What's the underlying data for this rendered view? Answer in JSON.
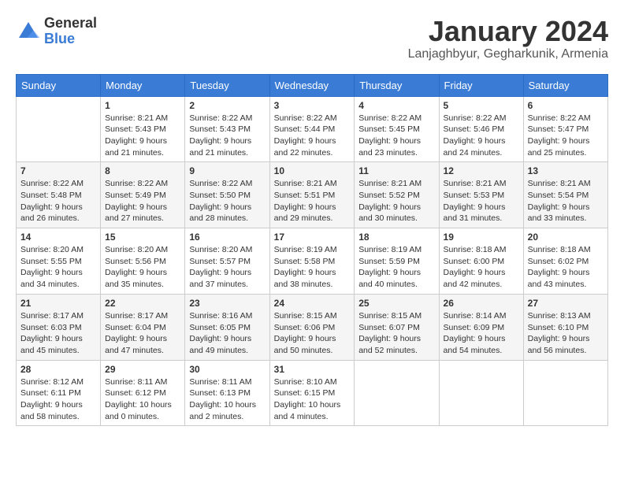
{
  "header": {
    "logo_general": "General",
    "logo_blue": "Blue",
    "month_title": "January 2024",
    "location": "Lanjaghbyur, Gegharkunik, Armenia"
  },
  "calendar": {
    "days_of_week": [
      "Sunday",
      "Monday",
      "Tuesday",
      "Wednesday",
      "Thursday",
      "Friday",
      "Saturday"
    ],
    "weeks": [
      [
        {
          "day": "",
          "sunrise": "",
          "sunset": "",
          "daylight": ""
        },
        {
          "day": "1",
          "sunrise": "Sunrise: 8:21 AM",
          "sunset": "Sunset: 5:43 PM",
          "daylight": "Daylight: 9 hours and 21 minutes."
        },
        {
          "day": "2",
          "sunrise": "Sunrise: 8:22 AM",
          "sunset": "Sunset: 5:43 PM",
          "daylight": "Daylight: 9 hours and 21 minutes."
        },
        {
          "day": "3",
          "sunrise": "Sunrise: 8:22 AM",
          "sunset": "Sunset: 5:44 PM",
          "daylight": "Daylight: 9 hours and 22 minutes."
        },
        {
          "day": "4",
          "sunrise": "Sunrise: 8:22 AM",
          "sunset": "Sunset: 5:45 PM",
          "daylight": "Daylight: 9 hours and 23 minutes."
        },
        {
          "day": "5",
          "sunrise": "Sunrise: 8:22 AM",
          "sunset": "Sunset: 5:46 PM",
          "daylight": "Daylight: 9 hours and 24 minutes."
        },
        {
          "day": "6",
          "sunrise": "Sunrise: 8:22 AM",
          "sunset": "Sunset: 5:47 PM",
          "daylight": "Daylight: 9 hours and 25 minutes."
        }
      ],
      [
        {
          "day": "7",
          "sunrise": "Sunrise: 8:22 AM",
          "sunset": "Sunset: 5:48 PM",
          "daylight": "Daylight: 9 hours and 26 minutes."
        },
        {
          "day": "8",
          "sunrise": "Sunrise: 8:22 AM",
          "sunset": "Sunset: 5:49 PM",
          "daylight": "Daylight: 9 hours and 27 minutes."
        },
        {
          "day": "9",
          "sunrise": "Sunrise: 8:22 AM",
          "sunset": "Sunset: 5:50 PM",
          "daylight": "Daylight: 9 hours and 28 minutes."
        },
        {
          "day": "10",
          "sunrise": "Sunrise: 8:21 AM",
          "sunset": "Sunset: 5:51 PM",
          "daylight": "Daylight: 9 hours and 29 minutes."
        },
        {
          "day": "11",
          "sunrise": "Sunrise: 8:21 AM",
          "sunset": "Sunset: 5:52 PM",
          "daylight": "Daylight: 9 hours and 30 minutes."
        },
        {
          "day": "12",
          "sunrise": "Sunrise: 8:21 AM",
          "sunset": "Sunset: 5:53 PM",
          "daylight": "Daylight: 9 hours and 31 minutes."
        },
        {
          "day": "13",
          "sunrise": "Sunrise: 8:21 AM",
          "sunset": "Sunset: 5:54 PM",
          "daylight": "Daylight: 9 hours and 33 minutes."
        }
      ],
      [
        {
          "day": "14",
          "sunrise": "Sunrise: 8:20 AM",
          "sunset": "Sunset: 5:55 PM",
          "daylight": "Daylight: 9 hours and 34 minutes."
        },
        {
          "day": "15",
          "sunrise": "Sunrise: 8:20 AM",
          "sunset": "Sunset: 5:56 PM",
          "daylight": "Daylight: 9 hours and 35 minutes."
        },
        {
          "day": "16",
          "sunrise": "Sunrise: 8:20 AM",
          "sunset": "Sunset: 5:57 PM",
          "daylight": "Daylight: 9 hours and 37 minutes."
        },
        {
          "day": "17",
          "sunrise": "Sunrise: 8:19 AM",
          "sunset": "Sunset: 5:58 PM",
          "daylight": "Daylight: 9 hours and 38 minutes."
        },
        {
          "day": "18",
          "sunrise": "Sunrise: 8:19 AM",
          "sunset": "Sunset: 5:59 PM",
          "daylight": "Daylight: 9 hours and 40 minutes."
        },
        {
          "day": "19",
          "sunrise": "Sunrise: 8:18 AM",
          "sunset": "Sunset: 6:00 PM",
          "daylight": "Daylight: 9 hours and 42 minutes."
        },
        {
          "day": "20",
          "sunrise": "Sunrise: 8:18 AM",
          "sunset": "Sunset: 6:02 PM",
          "daylight": "Daylight: 9 hours and 43 minutes."
        }
      ],
      [
        {
          "day": "21",
          "sunrise": "Sunrise: 8:17 AM",
          "sunset": "Sunset: 6:03 PM",
          "daylight": "Daylight: 9 hours and 45 minutes."
        },
        {
          "day": "22",
          "sunrise": "Sunrise: 8:17 AM",
          "sunset": "Sunset: 6:04 PM",
          "daylight": "Daylight: 9 hours and 47 minutes."
        },
        {
          "day": "23",
          "sunrise": "Sunrise: 8:16 AM",
          "sunset": "Sunset: 6:05 PM",
          "daylight": "Daylight: 9 hours and 49 minutes."
        },
        {
          "day": "24",
          "sunrise": "Sunrise: 8:15 AM",
          "sunset": "Sunset: 6:06 PM",
          "daylight": "Daylight: 9 hours and 50 minutes."
        },
        {
          "day": "25",
          "sunrise": "Sunrise: 8:15 AM",
          "sunset": "Sunset: 6:07 PM",
          "daylight": "Daylight: 9 hours and 52 minutes."
        },
        {
          "day": "26",
          "sunrise": "Sunrise: 8:14 AM",
          "sunset": "Sunset: 6:09 PM",
          "daylight": "Daylight: 9 hours and 54 minutes."
        },
        {
          "day": "27",
          "sunrise": "Sunrise: 8:13 AM",
          "sunset": "Sunset: 6:10 PM",
          "daylight": "Daylight: 9 hours and 56 minutes."
        }
      ],
      [
        {
          "day": "28",
          "sunrise": "Sunrise: 8:12 AM",
          "sunset": "Sunset: 6:11 PM",
          "daylight": "Daylight: 9 hours and 58 minutes."
        },
        {
          "day": "29",
          "sunrise": "Sunrise: 8:11 AM",
          "sunset": "Sunset: 6:12 PM",
          "daylight": "Daylight: 10 hours and 0 minutes."
        },
        {
          "day": "30",
          "sunrise": "Sunrise: 8:11 AM",
          "sunset": "Sunset: 6:13 PM",
          "daylight": "Daylight: 10 hours and 2 minutes."
        },
        {
          "day": "31",
          "sunrise": "Sunrise: 8:10 AM",
          "sunset": "Sunset: 6:15 PM",
          "daylight": "Daylight: 10 hours and 4 minutes."
        },
        {
          "day": "",
          "sunrise": "",
          "sunset": "",
          "daylight": ""
        },
        {
          "day": "",
          "sunrise": "",
          "sunset": "",
          "daylight": ""
        },
        {
          "day": "",
          "sunrise": "",
          "sunset": "",
          "daylight": ""
        }
      ]
    ]
  }
}
